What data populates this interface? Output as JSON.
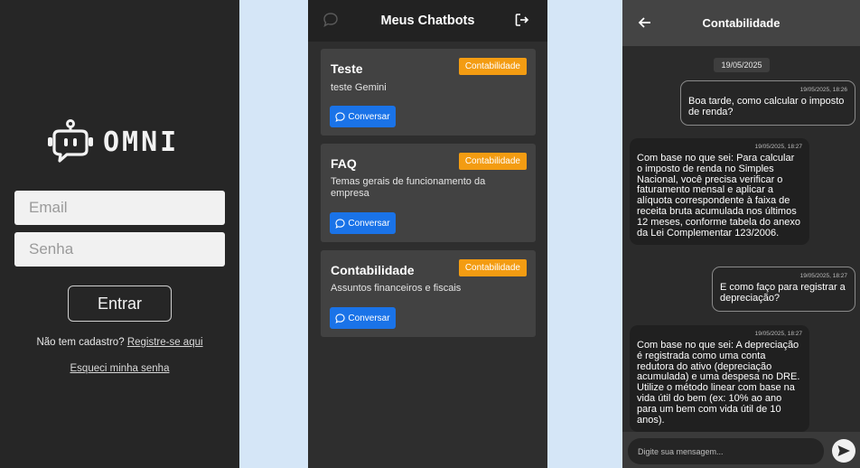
{
  "login": {
    "brand": "OMNI",
    "email_placeholder": "Email",
    "password_placeholder": "Senha",
    "submit_label": "Entrar",
    "signup_prompt": "Não tem cadastro?",
    "signup_link": "Registre-se aqui",
    "forgot_link": "Esqueci minha senha"
  },
  "chatbots": {
    "title": "Meus Chatbots",
    "cards": [
      {
        "name": "Teste",
        "category": "Contabilidade",
        "description": "teste Gemini",
        "action": "Conversar"
      },
      {
        "name": "FAQ",
        "category": "Contabilidade",
        "description": "Temas gerais de funcionamento da empresa",
        "action": "Conversar"
      },
      {
        "name": "Contabilidade",
        "category": "Contabilidade",
        "description": "Assuntos financeiros e fiscais",
        "action": "Conversar"
      }
    ]
  },
  "chat": {
    "title": "Contabilidade",
    "date": "19/05/2025",
    "messages": [
      {
        "role": "user",
        "time": "19/05/2025, 18:26",
        "text": "Boa tarde, como calcular o imposto de renda?"
      },
      {
        "role": "bot",
        "time": "19/05/2025, 18:27",
        "text": "Com base no que sei: Para calcular o imposto de renda no Simples Nacional, você precisa verificar o faturamento mensal e aplicar a alíquota correspondente à faixa de receita bruta acumulada nos últimos 12 meses, conforme tabela do anexo da Lei Complementar 123/2006."
      },
      {
        "role": "user",
        "time": "19/05/2025, 18:27",
        "text": "E como faço para registrar a depreciação?"
      },
      {
        "role": "bot",
        "time": "19/05/2025, 18:27",
        "text": "Com base no que sei: A depreciação é registrada como uma conta redutora do ativo (depreciação acumulada) e uma despesa no DRE. Utilize o método linear com base na vida útil do bem (ex: 10% ao ano para um bem com vida útil de 10 anos)."
      }
    ],
    "input_placeholder": "Digite sua mensagem..."
  },
  "colors": {
    "badge": "#f39c12",
    "primary_button": "#1a73e8",
    "background": "#cfe2f5"
  }
}
